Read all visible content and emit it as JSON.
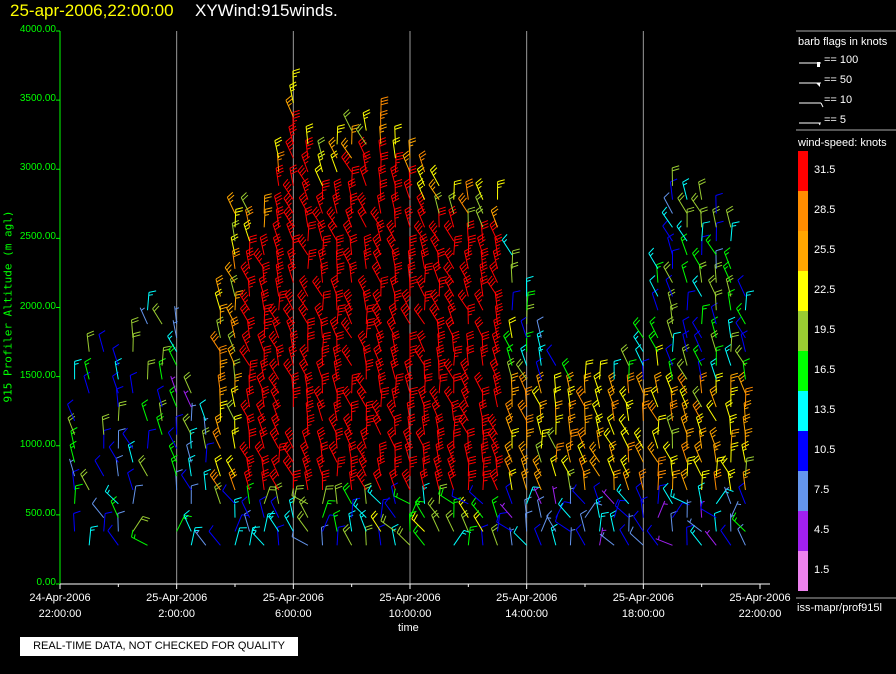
{
  "header": {
    "date": "25-apr-2006,22:00:00",
    "title": "XYWind:915winds."
  },
  "legend": {
    "flags_title": "barb flags in knots",
    "flags": [
      {
        "label": "== 100",
        "knots": 100
      },
      {
        "label": "== 50",
        "knots": 50
      },
      {
        "label": "== 10",
        "knots": 10
      },
      {
        "label": "== 5",
        "knots": 5
      }
    ],
    "speed_title": "wind-speed: knots",
    "bins": [
      {
        "label": "31.5",
        "color": "#ff0000"
      },
      {
        "label": "28.5",
        "color": "#ff8c00"
      },
      {
        "label": "25.5",
        "color": "#ffa500"
      },
      {
        "label": "22.5",
        "color": "#ffff00"
      },
      {
        "label": "19.5",
        "color": "#9acd32"
      },
      {
        "label": "16.5",
        "color": "#00ff00"
      },
      {
        "label": "13.5",
        "color": "#00ffff"
      },
      {
        "label": "10.5",
        "color": "#0000ff"
      },
      {
        "label": "7.5",
        "color": "#6495ed"
      },
      {
        "label": "4.5",
        "color": "#a020f0"
      },
      {
        "label": "1.5",
        "color": "#ee82ee"
      }
    ],
    "source": "iss-mapr/prof915l"
  },
  "quality_note": "REAL-TIME DATA, NOT CHECKED FOR QUALITY",
  "chart_data": {
    "type": "wind-barb",
    "xlabel": "time",
    "ylabel": "915 Profiler Altitude (m agl)",
    "xlim_hours": [
      0,
      24
    ],
    "ylim": [
      0,
      4000
    ],
    "grid": "vertical",
    "y_ticks": [
      "0.00",
      "500.00",
      "1000.00",
      "1500.00",
      "2000.00",
      "2500.00",
      "3000.00",
      "3500.00",
      "4000.00"
    ],
    "x_ticks": [
      {
        "hour": 0,
        "date": "24-Apr-2006",
        "time": "22:00:00"
      },
      {
        "hour": 4,
        "date": "25-Apr-2006",
        "time": "2:00:00"
      },
      {
        "hour": 8,
        "date": "25-Apr-2006",
        "time": "6:00:00"
      },
      {
        "hour": 12,
        "date": "25-Apr-2006",
        "time": "10:00:00"
      },
      {
        "hour": 16,
        "date": "25-Apr-2006",
        "time": "14:00:00"
      },
      {
        "hour": 20,
        "date": "25-Apr-2006",
        "time": "18:00:00"
      },
      {
        "hour": 24,
        "date": "25-Apr-2006",
        "time": "22:00:00"
      }
    ],
    "data_top_altitude_by_hour": [
      1700,
      1700,
      1700,
      2000,
      1900,
      1600,
      2700,
      2700,
      3600,
      3100,
      3300,
      3400,
      3100,
      2900,
      2800,
      2800,
      2100,
      1600,
      1500,
      1500,
      1800,
      2900,
      2800,
      2600,
      1700
    ]
  }
}
